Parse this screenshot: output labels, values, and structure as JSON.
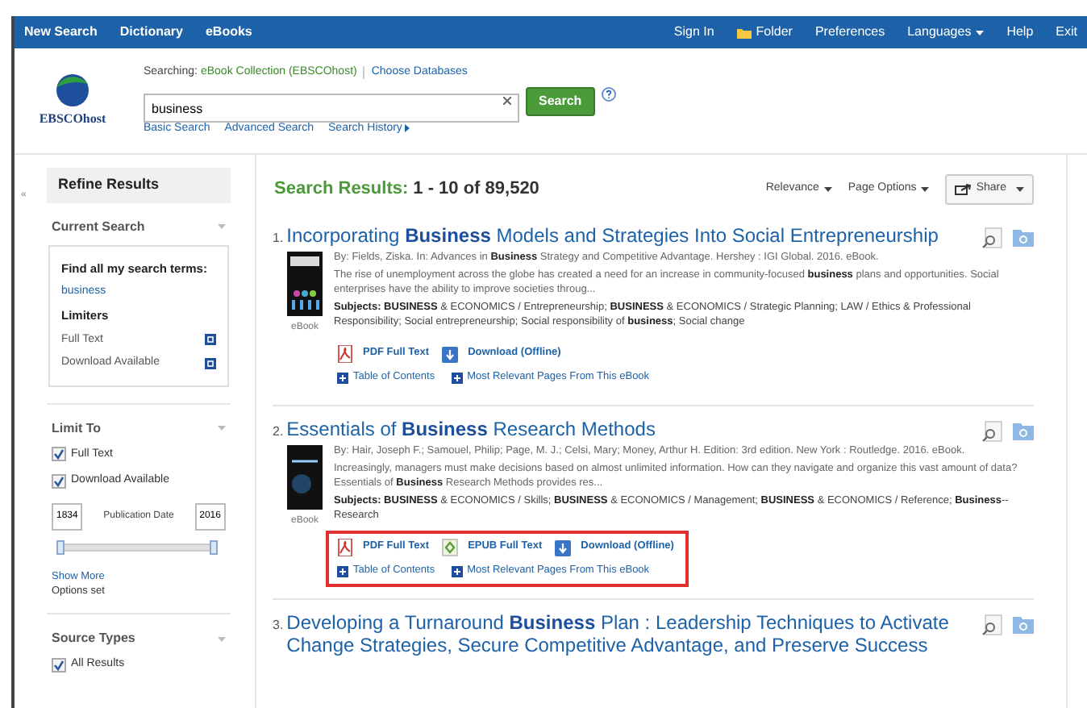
{
  "nav": {
    "left": [
      "New Search",
      "Dictionary",
      "eBooks"
    ],
    "right": [
      {
        "kind": "link",
        "label": "Sign In"
      },
      {
        "kind": "folder",
        "label": "Folder"
      },
      {
        "kind": "link",
        "label": "Preferences"
      },
      {
        "kind": "dropdown",
        "label": "Languages"
      },
      {
        "kind": "link",
        "label": "Help"
      },
      {
        "kind": "link",
        "label": "Exit"
      }
    ]
  },
  "header": {
    "logo": "EBSCOhost",
    "searching_label": "Searching:",
    "database": "eBook Collection (EBSCOhost)",
    "choose": "Choose Databases",
    "search_value": "business",
    "search_button": "Search",
    "links": [
      {
        "kind": "link",
        "label": "Basic Search"
      },
      {
        "kind": "link",
        "label": "Advanced Search"
      },
      {
        "kind": "menu",
        "label": "Search History"
      }
    ]
  },
  "sidebar": {
    "collapse": "«",
    "title": "Refine Results",
    "current_search": {
      "heading": "Current Search",
      "find_label": "Find all my search terms:",
      "term": "business",
      "limiters_heading": "Limiters",
      "limiters": [
        "Full Text",
        "Download Available"
      ]
    },
    "limit_to": {
      "heading": "Limit To",
      "options": [
        {
          "label": "Full Text",
          "checked": true
        },
        {
          "label": "Download Available",
          "checked": true
        }
      ],
      "date_from": "1834",
      "date_label": "Publication Date",
      "date_to": "2016",
      "date_range": {
        "level": 1
      },
      "show_more": "Show More",
      "options_set": "Options set"
    },
    "source_types": {
      "heading": "Source Types",
      "options": [
        {
          "label": "All Results",
          "checked": true
        }
      ]
    }
  },
  "results": {
    "label": "Search Results:",
    "range": "1 - 10 of 89,520",
    "sort": "Relevance",
    "page_options": "Page Options",
    "share": "Share",
    "items": [
      {
        "number": "1.",
        "title": "Incorporating **Business** Models and Strategies Into Social Entrepreneurship",
        "byline": "By: Fields, Ziska. In: Advances in **Business** Strategy and Competitive Advantage. Hershey : IGI Global. 2016. eBook.",
        "abstract": "The rise of unemployment across the globe has created a need for an increase in community-focused **business** plans and opportunities. Social enterprises have the ability to improve societies throug...",
        "subjects": "**Subjects: BUSINESS** & ECONOMICS / Entrepreneurship; **BUSINESS** & ECONOMICS / Strategic Planning; LAW / Ethics & Professional Responsibility; Social entrepreneurship; Social responsibility of **business**; Social change",
        "type": "eBook",
        "highlighted": false,
        "links": [
          {
            "kind": "pdf",
            "label": "PDF Full Text"
          },
          {
            "kind": "download",
            "label": "Download (Offline)"
          }
        ],
        "extras": [
          "Table of Contents",
          "Most Relevant Pages From This eBook"
        ]
      },
      {
        "number": "2.",
        "title": "Essentials of **Business** Research Methods",
        "byline": "By: Hair, Joseph F.; Samouel, Philip; Page, M. J.; Celsi, Mary; Money, Arthur H. Edition: 3rd edition. New York : Routledge. 2016. eBook.",
        "abstract": "Increasingly, managers must make decisions based on almost unlimited information. How can they navigate and organize this vast amount of data? Essentials of **Business** Research Methods provides res...",
        "subjects": "**Subjects: BUSINESS** & ECONOMICS / Skills; **BUSINESS** & ECONOMICS / Management; **BUSINESS** & ECONOMICS / Reference; **Business**--Research",
        "type": "eBook",
        "highlighted": true,
        "links": [
          {
            "kind": "pdf",
            "label": "PDF Full Text"
          },
          {
            "kind": "epub",
            "label": "EPUB Full Text"
          },
          {
            "kind": "download",
            "label": "Download (Offline)"
          }
        ],
        "extras": [
          "Table of Contents",
          "Most Relevant Pages From This eBook"
        ]
      },
      {
        "number": "3.",
        "title": "Developing a Turnaround **Business** Plan : Leadership Techniques to Activate Change Strategies, Secure Competitive Advantage, and Preserve Success"
      }
    ]
  }
}
